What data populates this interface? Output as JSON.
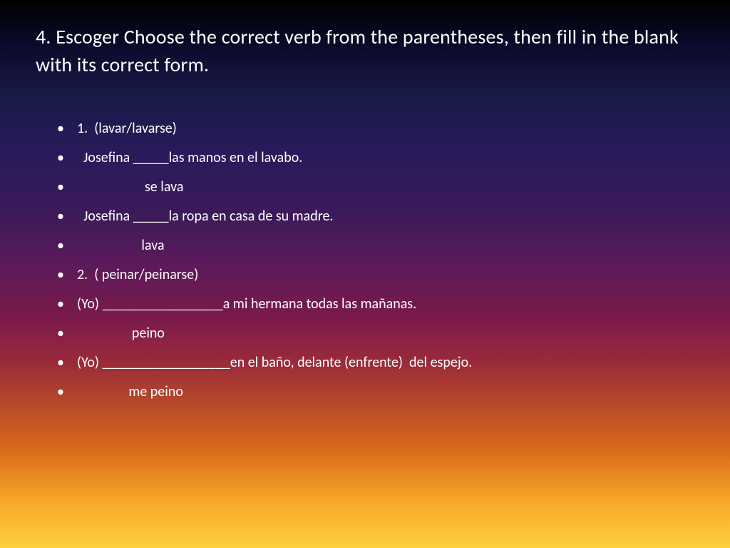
{
  "title": "4.  Escoger  Choose the correct verb from the parentheses, then fill in the blank with its correct form.",
  "lines": [
    "1.  (lavar/lavarse)",
    "  Josefina _____las manos en el lavabo.",
    "                     se lava",
    "  Josefina _____la ropa en casa de su madre.",
    "                    lava",
    "2.  ( peinar/peinarse)",
    "(Yo) _________________a mi hermana todas las mañanas.",
    "                 peino",
    "(Yo) __________________en el baño, delante (enfrente)  del espejo.",
    "                me peino"
  ]
}
